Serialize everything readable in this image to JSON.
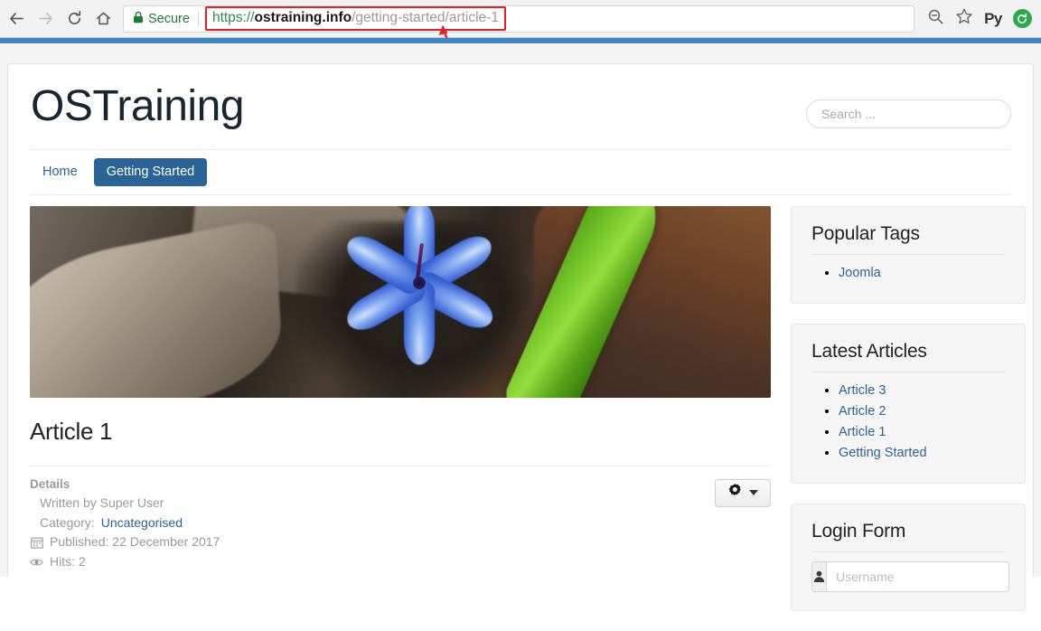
{
  "browser": {
    "back_icon": "back-arrow-icon",
    "forward_icon": "forward-arrow-icon",
    "reload_icon": "reload-icon",
    "home_icon": "home-icon",
    "security_label": "Secure",
    "lock_icon": "lock-icon",
    "url": {
      "scheme": "https://",
      "host": "ostraining.info",
      "path": "/getting-started/article-1",
      "full": "https://ostraining.info/getting-started/article-1",
      "highlight_color": "#ec1c24"
    },
    "right_icons": [
      {
        "name": "zoom-out-icon",
        "label": ""
      },
      {
        "name": "bookmark-star-icon",
        "label": ""
      },
      {
        "name": "python-extension-icon",
        "label": "Py"
      },
      {
        "name": "profile-avatar-icon",
        "label": ""
      }
    ],
    "loading_bar_color": "#3d86c6"
  },
  "site": {
    "title": "OSTraining",
    "search": {
      "placeholder": "Search ...",
      "value": ""
    },
    "nav": [
      {
        "label": "Home",
        "active": false
      },
      {
        "label": "Getting Started",
        "active": true
      }
    ],
    "accent_color": "#2a6496"
  },
  "article": {
    "hero_alt": "blue-flower-photo",
    "title": "Article 1",
    "details_label": "Details",
    "meta": {
      "author_line": "Written by Super User",
      "category_label": "Category:",
      "category_value": "Uncategorised",
      "published_icon": "calendar-icon",
      "published_line": "Published: 22 December 2017",
      "hits_icon": "eye-icon",
      "hits_line": "Hits: 2"
    },
    "options_button": {
      "icon": "gear-icon",
      "caret": "chevron-down-icon"
    }
  },
  "sidebar": {
    "modules": [
      {
        "title": "Popular Tags",
        "items": [
          {
            "label": "Joomla"
          }
        ]
      },
      {
        "title": "Latest Articles",
        "items": [
          {
            "label": "Article 3"
          },
          {
            "label": "Article 2"
          },
          {
            "label": "Article 1"
          },
          {
            "label": "Getting Started"
          }
        ]
      }
    ],
    "login": {
      "title": "Login Form",
      "username_icon": "user-icon",
      "username_placeholder": "Username",
      "username_value": ""
    }
  }
}
